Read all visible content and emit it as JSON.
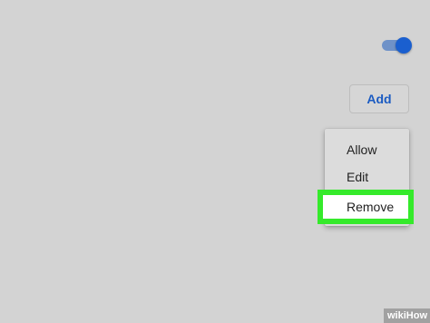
{
  "toggle": {
    "state": "on",
    "accent_color": "#1a5fcf"
  },
  "add_button": {
    "label": "Add",
    "color": "#1b5bc2"
  },
  "context_menu": {
    "items": [
      {
        "label": "Allow"
      },
      {
        "label": "Edit"
      },
      {
        "label": "Remove",
        "highlighted": true
      }
    ],
    "highlight_color": "#35ea2b"
  },
  "watermark": {
    "text": "wikiHow"
  }
}
